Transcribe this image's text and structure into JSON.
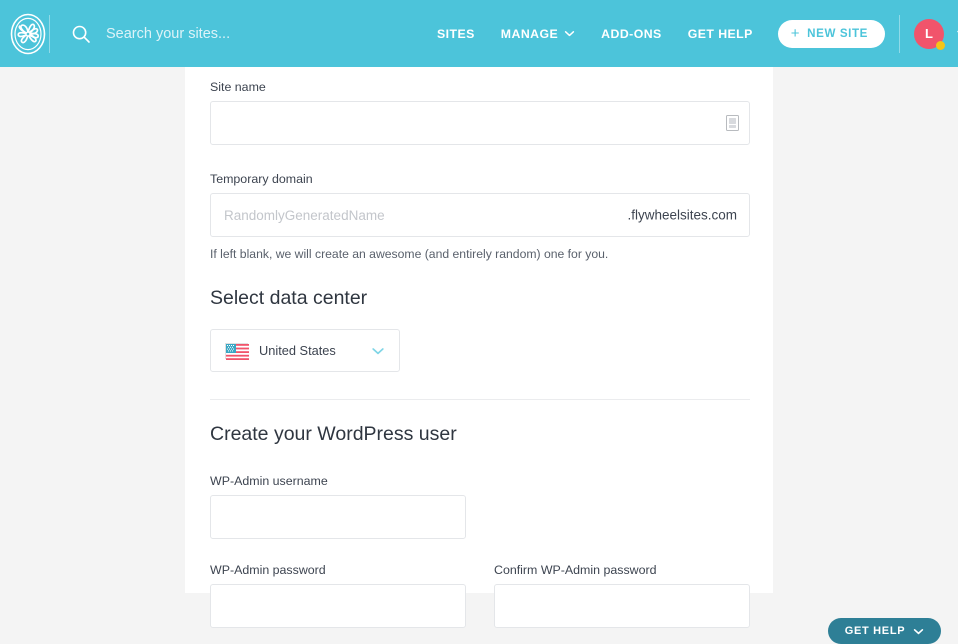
{
  "header": {
    "logo_name": "flywheel-pinwheel-logo",
    "search": {
      "placeholder": "Search your sites...",
      "value": ""
    },
    "nav": [
      {
        "label": "SITES",
        "has_caret": false
      },
      {
        "label": "MANAGE",
        "has_caret": true
      },
      {
        "label": "ADD-ONS",
        "has_caret": false
      },
      {
        "label": "GET HELP",
        "has_caret": false
      }
    ],
    "new_site_button": {
      "label": "NEW SITE",
      "plus": "+"
    },
    "account": {
      "avatar_initial": "L",
      "status_color": "#f5c518",
      "avatar_color": "#f1546b"
    }
  },
  "form": {
    "site_name": {
      "label": "Site name",
      "value": "",
      "placeholder": ""
    },
    "temporary_domain": {
      "label": "Temporary domain",
      "value": "",
      "placeholder": "RandomlyGeneratedName",
      "suffix": ".flywheelsites.com",
      "helper": "If left blank, we will create an awesome (and entirely random) one for you."
    },
    "data_center": {
      "heading": "Select data center",
      "selected": "United States",
      "flag": "us-flag-icon"
    },
    "wordpress_user": {
      "heading": "Create your WordPress user",
      "username": {
        "label": "WP-Admin username",
        "value": "",
        "placeholder": ""
      },
      "password": {
        "label": "WP-Admin password",
        "value": "",
        "placeholder": ""
      },
      "confirm_password": {
        "label": "Confirm WP-Admin password",
        "value": "",
        "placeholder": ""
      }
    }
  },
  "support": {
    "get_help_label": "GET HELP"
  },
  "colors": {
    "header_teal": "#4cc4da",
    "accent_coral": "#f1546b",
    "fab_teal": "#2e7f96",
    "page_bg": "#f4f4f4"
  }
}
